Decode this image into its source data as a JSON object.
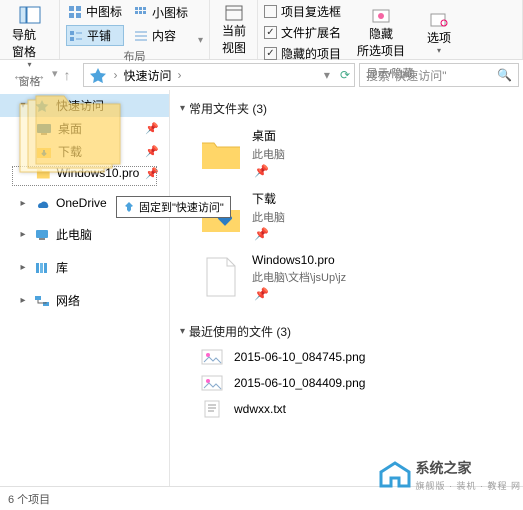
{
  "ribbon": {
    "group1": {
      "nav_pane_label": "导航窗格",
      "item_a1": "中图标",
      "item_a2": "平铺",
      "item_b1": "小图标",
      "item_b2": "内容",
      "group_label": "窗格",
      "group_label2": "布局"
    },
    "group2": {
      "current_view": "当前\n视图",
      "cb1": "项目复选框",
      "cb2": "文件扩展名",
      "cb3": "隐藏的项目",
      "hide_btn": "隐藏\n所选项目",
      "options_btn": "选项",
      "group_label": "显示/隐藏"
    }
  },
  "addrbar": {
    "bc1": "快速访问",
    "search_placeholder": "搜索\"快速访问\""
  },
  "sidebar": {
    "quick_access": "快速访问",
    "items": [
      {
        "label": "桌面",
        "pinned": true
      },
      {
        "label": "下载",
        "pinned": true
      },
      {
        "label": "Windows10.pro",
        "pinned": true
      }
    ],
    "onedrive": "OneDrive",
    "this_pc": "此电脑",
    "libraries": "库",
    "network": "网络"
  },
  "content": {
    "section1_title": "常用文件夹 (3)",
    "tiles": [
      {
        "name": "桌面",
        "sub": "此电脑",
        "type": "folder"
      },
      {
        "name": "下载",
        "sub": "此电脑",
        "type": "download"
      },
      {
        "name": "Windows10.pro",
        "sub": "此电脑\\文档\\jsUp\\jz",
        "type": "file"
      }
    ],
    "section2_title": "最近使用的文件 (3)",
    "files": [
      {
        "name": "2015-06-10_084745.png",
        "type": "png"
      },
      {
        "name": "2015-06-10_084409.png",
        "type": "png"
      },
      {
        "name": "wdwxx.txt",
        "type": "txt"
      }
    ]
  },
  "drag": {
    "tooltip": "固定到\"快速访问\""
  },
  "status": {
    "items": "6 个项目"
  },
  "watermark": {
    "title": "系统之家",
    "sub": "旗舰版 · 装机 · 教程 网"
  }
}
